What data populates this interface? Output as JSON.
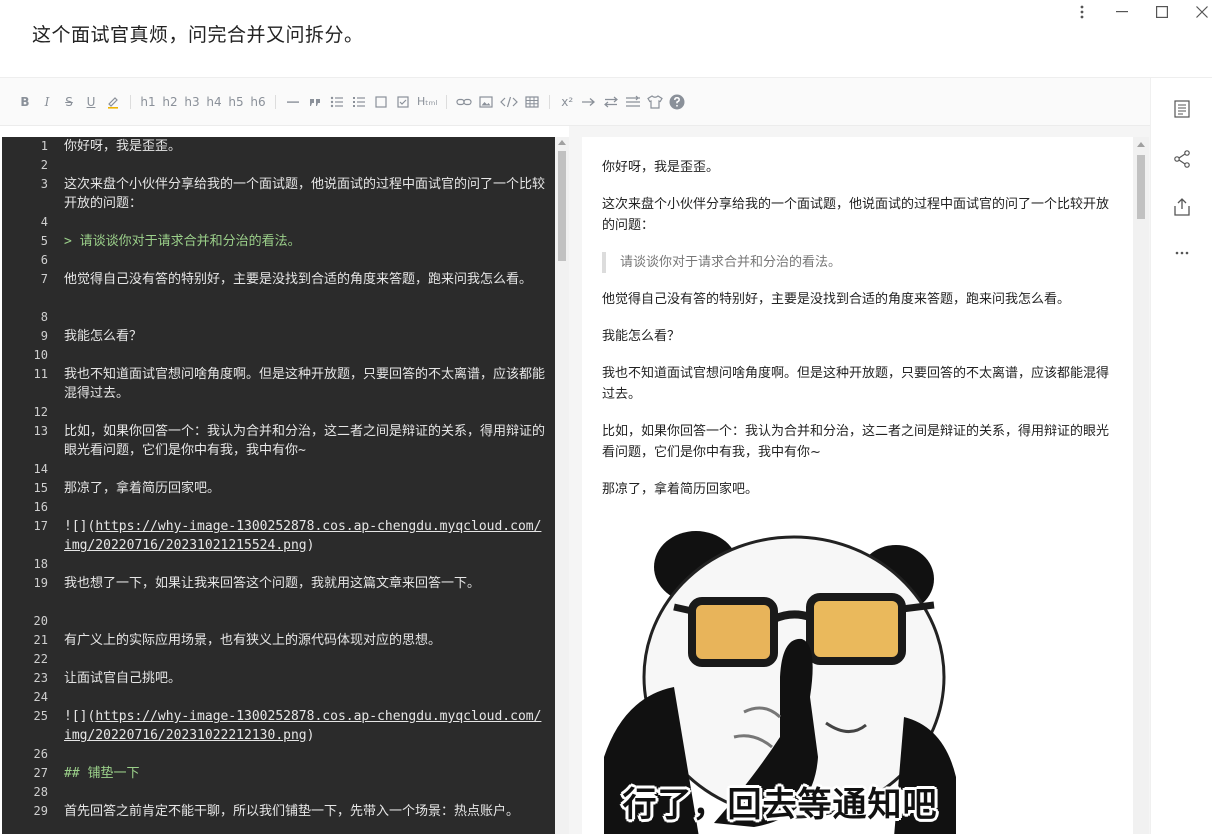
{
  "window": {
    "title": "这个面试官真烦，问完合并又问拆分。",
    "controls": [
      "more-vertical-icon",
      "minimize-icon",
      "maximize-icon",
      "close-icon"
    ]
  },
  "toolbar": {
    "bold": "B",
    "italic": "I",
    "strike": "S",
    "underline": "U",
    "h1": "h1",
    "h2": "h2",
    "h3": "h3",
    "h4": "h4",
    "h5": "h5",
    "h6": "h6",
    "html": "Hₜₘₗ",
    "superscript": "x²"
  },
  "editor": {
    "lines": [
      {
        "n": "1",
        "text": "你好呀，我是歪歪。",
        "kind": "text"
      },
      {
        "n": "2",
        "text": "",
        "kind": "text"
      },
      {
        "n": "3",
        "text": "这次来盘个小伙伴分享给我的一个面试题，他说面试的过程中面试官的问了一个比较开放的问题：",
        "kind": "text"
      },
      {
        "n": "4",
        "text": "",
        "kind": "text"
      },
      {
        "n": "5",
        "text": "> 请谈谈你对于请求合并和分治的看法。",
        "kind": "quote"
      },
      {
        "n": "6",
        "text": "",
        "kind": "text"
      },
      {
        "n": "7",
        "text": "他觉得自己没有答的特别好，主要是没找到合适的角度来答题，跑来问我怎么看。",
        "kind": "text"
      },
      {
        "n": "8",
        "text": "",
        "kind": "text"
      },
      {
        "n": "9",
        "text": "我能怎么看？",
        "kind": "text"
      },
      {
        "n": "10",
        "text": "",
        "kind": "text"
      },
      {
        "n": "11",
        "text": "我也不知道面试官想问啥角度啊。但是这种开放题，只要回答的不太离谱，应该都能混得过去。",
        "kind": "text"
      },
      {
        "n": "12",
        "text": "",
        "kind": "text"
      },
      {
        "n": "13",
        "text": "比如，如果你回答一个：我认为合并和分治，这二者之间是辩证的关系，得用辩证的眼光看问题，它们是你中有我，我中有你~",
        "kind": "text"
      },
      {
        "n": "14",
        "text": "",
        "kind": "text"
      },
      {
        "n": "15",
        "text": "那凉了，拿着简历回家吧。",
        "kind": "text"
      },
      {
        "n": "16",
        "text": "",
        "kind": "text"
      },
      {
        "n": "17",
        "text": "![](",
        "url": "https://why-image-1300252878.cos.ap-chengdu.myqcloud.com/img/20220716/20231021215524.png",
        "close": ")",
        "kind": "link"
      },
      {
        "n": "18",
        "text": "",
        "kind": "text"
      },
      {
        "n": "19",
        "text": "我也想了一下，如果让我来回答这个问题，我就用这篇文章来回答一下。",
        "kind": "text"
      },
      {
        "n": "20",
        "text": "",
        "kind": "text"
      },
      {
        "n": "21",
        "text": "有广义上的实际应用场景，也有狭义上的源代码体现对应的思想。",
        "kind": "text"
      },
      {
        "n": "22",
        "text": "",
        "kind": "text"
      },
      {
        "n": "23",
        "text": "让面试官自己挑吧。",
        "kind": "text"
      },
      {
        "n": "24",
        "text": "",
        "kind": "text"
      },
      {
        "n": "25",
        "text": "![](",
        "url": "https://why-image-1300252878.cos.ap-chengdu.myqcloud.com/img/20220716/20231022212130.png",
        "close": ")",
        "kind": "link"
      },
      {
        "n": "26",
        "text": "",
        "kind": "text"
      },
      {
        "n": "27",
        "text": "## 铺垫一下",
        "kind": "heading"
      },
      {
        "n": "28",
        "text": "",
        "kind": "text"
      },
      {
        "n": "29",
        "text": "首先回答之前肯定不能干聊，所以我们铺垫一下，先带入一个场景：热点账户。",
        "kind": "text"
      }
    ]
  },
  "preview": {
    "p1": "你好呀，我是歪歪。",
    "p2": "这次来盘个小伙伴分享给我的一个面试题，他说面试的过程中面试官的问了一个比较开放的问题：",
    "quote": "请谈谈你对于请求合并和分治的看法。",
    "p3": "他觉得自己没有答的特别好，主要是没找到合适的角度来答题，跑来问我怎么看。",
    "p4": "我能怎么看？",
    "p5": "我也不知道面试官想问啥角度啊。但是这种开放题，只要回答的不太离谱，应该都能混得过去。",
    "p6": "比如，如果你回答一个：我认为合并和分治，这二者之间是辩证的关系，得用辩证的眼光看问题，它们是你中有我，我中有你~",
    "p7": "那凉了，拿着简历回家吧。",
    "meme_caption": "行了，回去等通知吧"
  },
  "rail": [
    "outline-icon",
    "share-icon",
    "export-icon",
    "more-horizontal-icon"
  ]
}
